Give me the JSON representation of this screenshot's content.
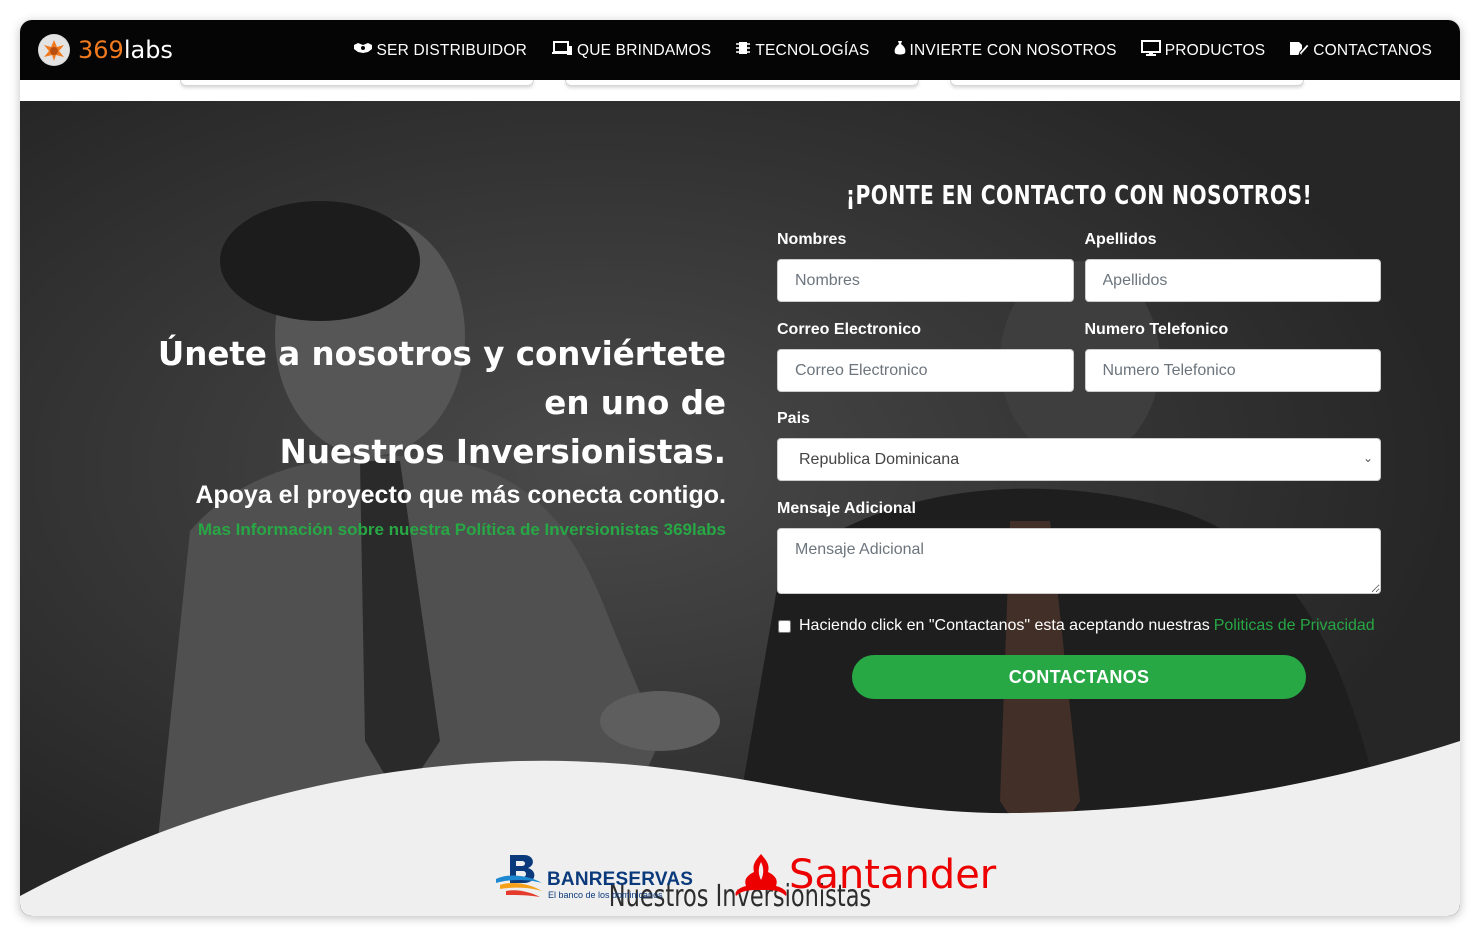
{
  "brand": {
    "prefix": "369",
    "suffix": "labs",
    "accent": "#f07a20"
  },
  "nav": {
    "items": [
      {
        "label": "SER DISTRIBUIDOR",
        "icon": "handshake-icon"
      },
      {
        "label": "QUE BRINDAMOS",
        "icon": "devices-icon"
      },
      {
        "label": "TECNOLOGÍAS",
        "icon": "chip-icon"
      },
      {
        "label": "INVIERTE CON NOSOTROS",
        "icon": "money-bag-icon"
      },
      {
        "label": "PRODUCTOS",
        "icon": "desktop-icon"
      },
      {
        "label": "CONTACTANOS",
        "icon": "edit-icon"
      }
    ]
  },
  "hero": {
    "headline_1": "Únete a nosotros y conviértete",
    "headline_2": "en uno de",
    "headline_3": "Nuestros Inversionistas.",
    "subheadline": "Apoya el proyecto que más conecta contigo.",
    "more_link": "Mas Información sobre nuestra Política de Inversionistas 369labs"
  },
  "form": {
    "title": "¡PONTE EN CONTACTO CON NOSOTROS!",
    "nombres": {
      "label": "Nombres",
      "placeholder": "Nombres"
    },
    "apellidos": {
      "label": "Apellidos",
      "placeholder": "Apellidos"
    },
    "correo": {
      "label": "Correo Electronico",
      "placeholder": "Correo Electronico"
    },
    "telefono": {
      "label": "Numero Telefonico",
      "placeholder": "Numero Telefonico"
    },
    "pais": {
      "label": "Pais",
      "selected": "Republica Dominicana"
    },
    "mensaje": {
      "label": "Mensaje Adicional",
      "placeholder": "Mensaje Adicional"
    },
    "consent_text": "Haciendo click en \"Contactanos\" esta aceptando nuestras",
    "consent_link": "Politicas de Privacidad",
    "submit": "CONTACTANOS"
  },
  "investors": {
    "title": "Nuestros Inversionistas",
    "banreservas": {
      "name": "BANRESERVAS",
      "tagline": "El banco de los dominicanos"
    },
    "santander": {
      "name": "Santander"
    }
  },
  "colors": {
    "green": "#28a745",
    "nav_bg": "#050505",
    "santander_red": "#ec0000",
    "banreservas_blue": "#0b3a7c"
  }
}
